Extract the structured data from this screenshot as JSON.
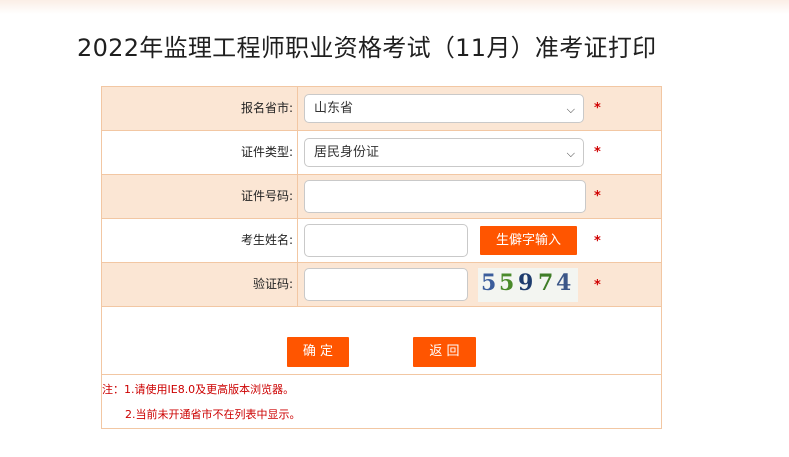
{
  "page": {
    "title": "2022年监理工程师职业资格考试（11月）准考证打印"
  },
  "form": {
    "required_mark": "*",
    "fields": [
      {
        "label": "报名省市:",
        "value": "山东省"
      },
      {
        "label": "证件类型:",
        "value": "居民身份证"
      },
      {
        "label": "证件号码:",
        "value": ""
      },
      {
        "label": "考生姓名:",
        "value": ""
      },
      {
        "label": "验证码:",
        "value": ""
      }
    ],
    "rare_char_button": "生僻字输入",
    "captcha_chars": [
      "5",
      "5",
      "9",
      "7",
      "4"
    ],
    "captcha_colors": [
      "#3b5d9c",
      "#4a8a2a",
      "#1e3c6e",
      "#3f7d27",
      "#3c5788"
    ],
    "confirm_button": "确 定",
    "back_button": "返 回"
  },
  "notes": {
    "line1": "注：1.请使用IE8.0及更高版本浏览器。",
    "line2": "2.当前未开通省市不在列表中显示。"
  },
  "colors": {
    "accent": "#ff5500",
    "row_shade": "#fbe6d4",
    "border": "#f2c7a3",
    "required": "#d00000",
    "note": "#cc0000"
  }
}
